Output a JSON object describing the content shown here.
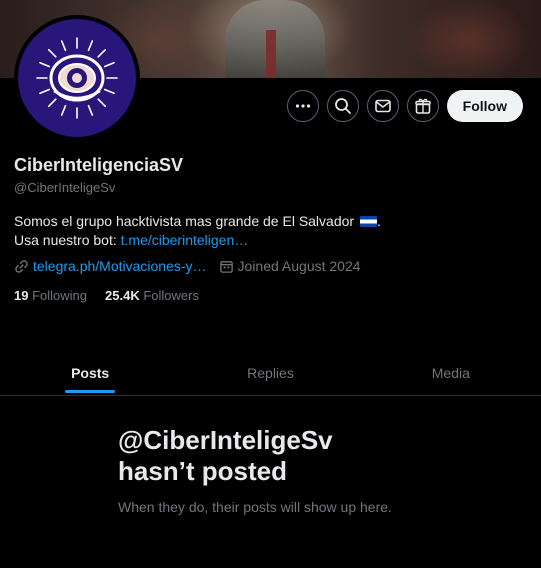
{
  "profile": {
    "display_name": "CiberInteligenciaSV",
    "handle": "@CiberInteligeSv",
    "bio_line1": "Somos el grupo hacktivista mas grande de El Salvador",
    "bio_line1_end": ".",
    "bio_line2_prefix": "Usa nuestro bot: ",
    "bio_link": "t.me/ciberinteligen…",
    "website": "telegra.ph/Motivaciones-y…",
    "joined": "Joined August 2024",
    "flag_icon": "el-salvador-flag-icon"
  },
  "stats": {
    "following_count": "19",
    "following_label": "Following",
    "followers_count": "25.4K",
    "followers_label": "Followers"
  },
  "actions": {
    "follow_label": "Follow",
    "icons": [
      "more-icon",
      "search-icon",
      "message-icon",
      "subscribe-icon"
    ]
  },
  "tabs": [
    {
      "label": "Posts",
      "active": true
    },
    {
      "label": "Replies",
      "active": false
    },
    {
      "label": "Media",
      "active": false
    }
  ],
  "empty_state": {
    "title_line1": "@CiberInteligeSv",
    "title_line2": "hasn’t posted",
    "subtitle": "When they do, their posts will show up here."
  },
  "colors": {
    "background": "#000000",
    "accent": "#1d9bf0",
    "avatar_bg": "#29167a",
    "text_primary": "#e7e9ea",
    "text_secondary": "#71767b"
  }
}
